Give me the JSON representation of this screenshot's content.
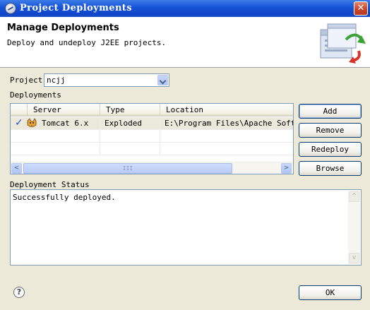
{
  "window": {
    "title": "Project Deployments",
    "close_glyph": "✕",
    "icon": "eclipse-icon"
  },
  "banner": {
    "title": "Manage Deployments",
    "description": "Deploy and undeploy J2EE projects."
  },
  "project": {
    "label": "Project",
    "value": "ncjj"
  },
  "deployments": {
    "label": "Deployments",
    "columns": [
      "Server",
      "Type",
      "Location"
    ],
    "rows": [
      {
        "status_glyph": "✓",
        "server": "Tomcat  6.x",
        "type": "Exploded",
        "location": "E:\\Program Files\\Apache Softwar"
      }
    ],
    "scroll": {
      "left": "<",
      "right": ">",
      "grip": "III"
    }
  },
  "actions": {
    "add": "Add",
    "remove": "Remove",
    "redeploy": "Redeploy",
    "browse": "Browse"
  },
  "status": {
    "label": "Deployment Status",
    "text": "Successfully deployed.",
    "scroll": {
      "up": "^",
      "down": "v"
    }
  },
  "footer": {
    "help": "?",
    "ok": "OK"
  },
  "colors": {
    "titlebar": "#0f45c8",
    "dialog": "#ece9d8",
    "check": "#2a52be",
    "border": "#7f9db9"
  }
}
